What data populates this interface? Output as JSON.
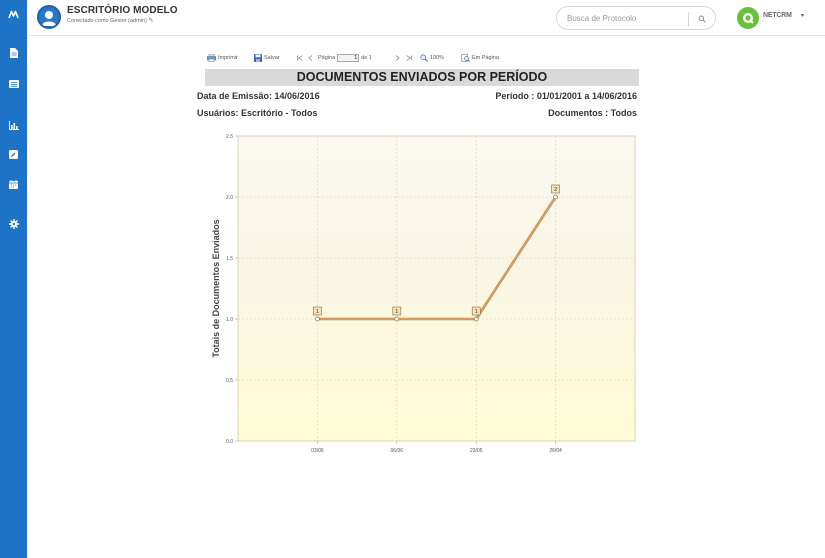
{
  "header": {
    "title": "ESCRITÓRIO MODELO",
    "subtitle": "Conectado como Gestor (admin)",
    "search_placeholder": "Busca de Protocolo",
    "brand": "NETCRM"
  },
  "sidebar": {
    "items": [
      {
        "icon": "logo-icon"
      },
      {
        "icon": "document-icon"
      },
      {
        "icon": "list-icon"
      },
      {
        "icon": "bar-chart-icon"
      },
      {
        "icon": "edit-icon"
      },
      {
        "icon": "calendar-icon"
      },
      {
        "icon": "gear-icon"
      }
    ]
  },
  "toolbar": {
    "print_label": "Imprimir",
    "save_label": "Salvar",
    "page_label": "Página",
    "page_value": "1",
    "page_of": "de 1",
    "zoom_label": "100%",
    "fit_label": "Em Página"
  },
  "report": {
    "title": "DOCUMENTOS ENVIADOS POR PERÍODO",
    "emission": "Data de Emissão: 14/06/2016",
    "period": "Período : 01/01/2001 a 14/06/2016",
    "users": "Usuários: Escritório - Todos",
    "documents": "Documentos : Todos"
  },
  "chart_data": {
    "type": "line",
    "categories": [
      "03/06",
      "06/06",
      "23/05",
      "26/04"
    ],
    "values": [
      1,
      1,
      1,
      2
    ],
    "data_labels": [
      "1",
      "1",
      "1",
      "2"
    ],
    "ylabel": "Totais de Documentos Enviados",
    "xlabel": "",
    "ylim": [
      0,
      2.5
    ],
    "yticks": [
      "0.0",
      "0.5",
      "1.0",
      "1.5",
      "2.0",
      "2.5"
    ],
    "grid": true,
    "line_color": "#e0a060",
    "legend": "none"
  }
}
